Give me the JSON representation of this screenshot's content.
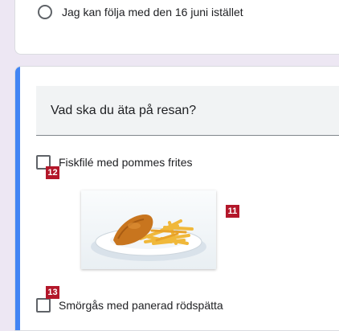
{
  "previous_question": {
    "option_label": "Jag kan följa med den 16 juni istället"
  },
  "question": {
    "title": "Vad ska du äta på resan?",
    "options": [
      {
        "label": "Fiskfilé med pommes frites",
        "badge": "12"
      },
      {
        "label": "Smörgås med panerad rödspätta",
        "badge": "13"
      }
    ],
    "image_badge": "11"
  },
  "colors": {
    "accent": "#4285f4",
    "badge": "#b3172a",
    "background": "#ede7f3"
  }
}
